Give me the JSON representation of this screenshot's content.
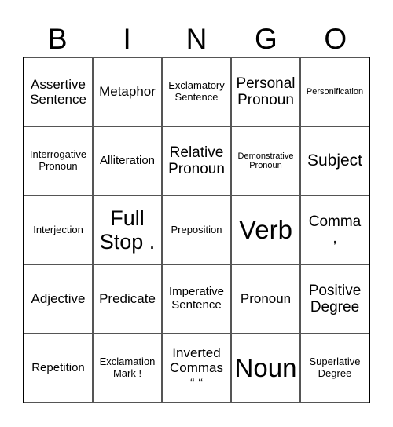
{
  "header": {
    "letters": [
      "B",
      "I",
      "N",
      "G",
      "O"
    ]
  },
  "grid": {
    "rows": [
      [
        "Assertive\nSentence",
        "Metaphor",
        "Exclamatory\nSentence",
        "Personal\nPronoun",
        "Personification"
      ],
      [
        "Interrogative\nPronoun",
        "Alliteration",
        "Relative\nPronoun",
        "Demonstrative\nPronoun",
        "Subject"
      ],
      [
        "Interjection",
        "Full\nStop .",
        "Preposition",
        "Verb",
        "Comma\n,"
      ],
      [
        "Adjective",
        "Predicate",
        "Imperative\nSentence",
        "Pronoun",
        "Positive\nDegree"
      ],
      [
        "Repetition",
        "Exclamation\nMark !",
        "Inverted\nCommas\n“ “",
        "Noun",
        "Superlative\nDegree"
      ]
    ]
  }
}
